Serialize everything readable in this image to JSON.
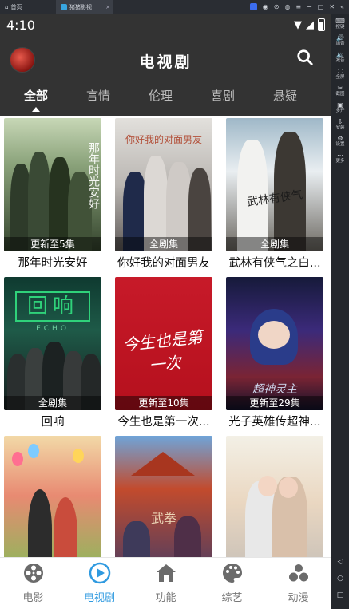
{
  "emulator": {
    "home_tab": "首页",
    "app_tab": "猪猪影视",
    "close": "×",
    "sidebar": [
      {
        "icon": "keyboard-icon",
        "glyph": "⌨",
        "label": "按键"
      },
      {
        "icon": "volume-up-icon",
        "glyph": "🔊",
        "label": "加音"
      },
      {
        "icon": "volume-down-icon",
        "glyph": "🔉",
        "label": "减音"
      },
      {
        "icon": "fullscreen-icon",
        "glyph": "⛶",
        "label": "全屏"
      },
      {
        "icon": "screenshot-icon",
        "glyph": "✂",
        "label": "截图"
      },
      {
        "icon": "multi-instance-icon",
        "glyph": "▣",
        "label": "多开"
      },
      {
        "icon": "install-icon",
        "glyph": "⇩",
        "label": "安装"
      },
      {
        "icon": "settings-icon",
        "glyph": "⚙",
        "label": "设置"
      },
      {
        "icon": "more-icon",
        "glyph": "⋯",
        "label": "更多"
      }
    ]
  },
  "status_bar": {
    "time": "4:10"
  },
  "header": {
    "title": "电视剧"
  },
  "tabs": [
    {
      "label": "全部",
      "active": true
    },
    {
      "label": "言情",
      "active": false
    },
    {
      "label": "伦理",
      "active": false
    },
    {
      "label": "喜剧",
      "active": false
    },
    {
      "label": "悬疑",
      "active": false
    }
  ],
  "posters": [
    {
      "name": "那年时光安好",
      "badge": "更新至5集",
      "art": "那年时光安好"
    },
    {
      "name": "你好我的对面男友",
      "badge": "全剧集",
      "art": "你好我的对面男友"
    },
    {
      "name": "武林有侠气之白...",
      "badge": "全剧集",
      "art": "武林有侠气"
    },
    {
      "name": "回响",
      "badge": "全剧集",
      "art": "回响"
    },
    {
      "name": "今生也是第一次...",
      "badge": "更新至10集",
      "art": "今生也是第一次"
    },
    {
      "name": "光子英雄传超神...",
      "badge": "更新至29集",
      "art": "超神灵主"
    },
    {
      "name": "",
      "badge": "",
      "art": ""
    },
    {
      "name": "",
      "badge": "",
      "art": "武拳"
    },
    {
      "name": "",
      "badge": "",
      "art": ""
    }
  ],
  "echo_sub": "ECHO",
  "bottom_nav": [
    {
      "label": "电影",
      "icon": "film-reel-icon",
      "active": false
    },
    {
      "label": "电视剧",
      "icon": "play-circle-icon",
      "active": true
    },
    {
      "label": "功能",
      "icon": "home-icon",
      "active": false
    },
    {
      "label": "综艺",
      "icon": "palette-icon",
      "active": false
    },
    {
      "label": "动漫",
      "icon": "bubbles-icon",
      "active": false
    }
  ],
  "colors": {
    "accent": "#2f9ae0",
    "header_bg": "#333333",
    "content_bg": "#ffffff"
  }
}
